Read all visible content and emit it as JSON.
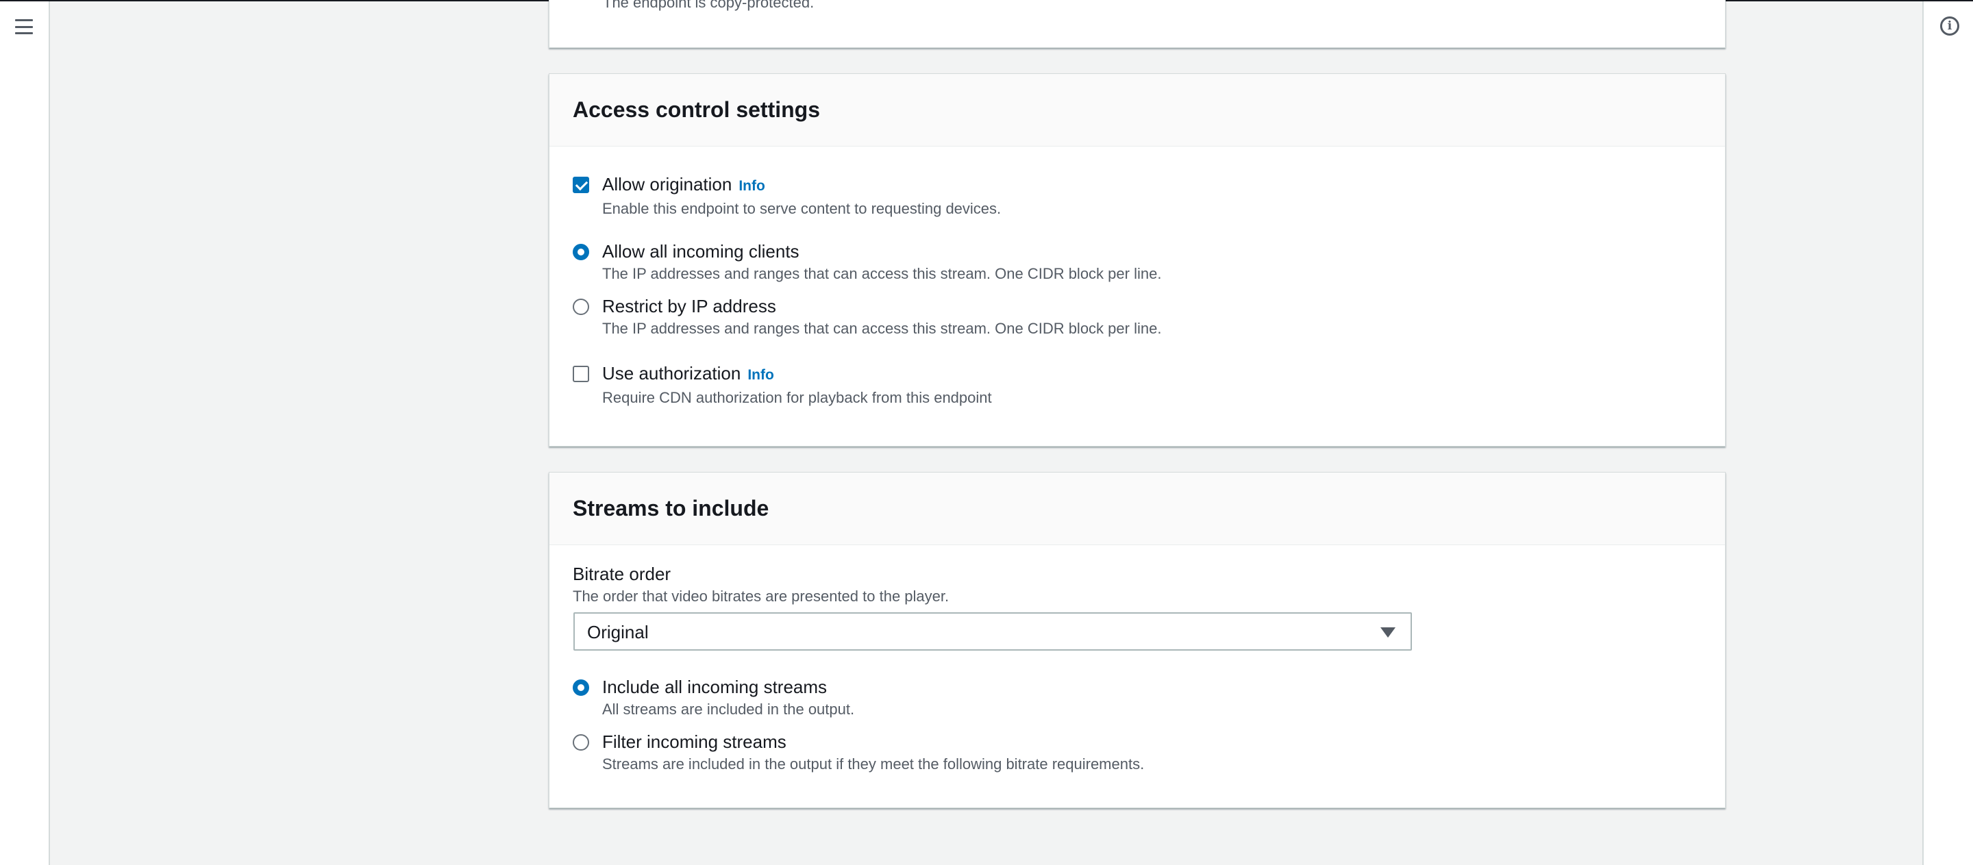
{
  "top_panel": {
    "partial_description": "The endpoint is copy-protected."
  },
  "access_control": {
    "title": "Access control settings",
    "allow_origination": {
      "label": "Allow origination",
      "info": "Info",
      "description": "Enable this endpoint to serve content to requesting devices.",
      "checked": true
    },
    "allow_all_clients": {
      "label": "Allow all incoming clients",
      "description": "The IP addresses and ranges that can access this stream. One CIDR block per line.",
      "selected": true
    },
    "restrict_by_ip": {
      "label": "Restrict by IP address",
      "description": "The IP addresses and ranges that can access this stream. One CIDR block per line.",
      "selected": false
    },
    "use_authorization": {
      "label": "Use authorization",
      "info": "Info",
      "description": "Require CDN authorization for playback from this endpoint",
      "checked": false
    }
  },
  "streams": {
    "title": "Streams to include",
    "bitrate_order": {
      "label": "Bitrate order",
      "description": "The order that video bitrates are presented to the player.",
      "selected_value": "Original"
    },
    "include_all": {
      "label": "Include all incoming streams",
      "description": "All streams are included in the output.",
      "selected": true
    },
    "filter_streams": {
      "label": "Filter incoming streams",
      "description": "Streams are included in the output if they meet the following bitrate requirements.",
      "selected": false
    }
  },
  "icons": {
    "menu": "hamburger-menu-icon",
    "info": "info-circle-icon",
    "select_caret": "caret-down-icon"
  },
  "colors": {
    "accent": "#0073bb",
    "page_background": "#f2f3f3",
    "panel_background": "#ffffff",
    "text_primary": "#16191f",
    "text_secondary": "#545b64"
  }
}
